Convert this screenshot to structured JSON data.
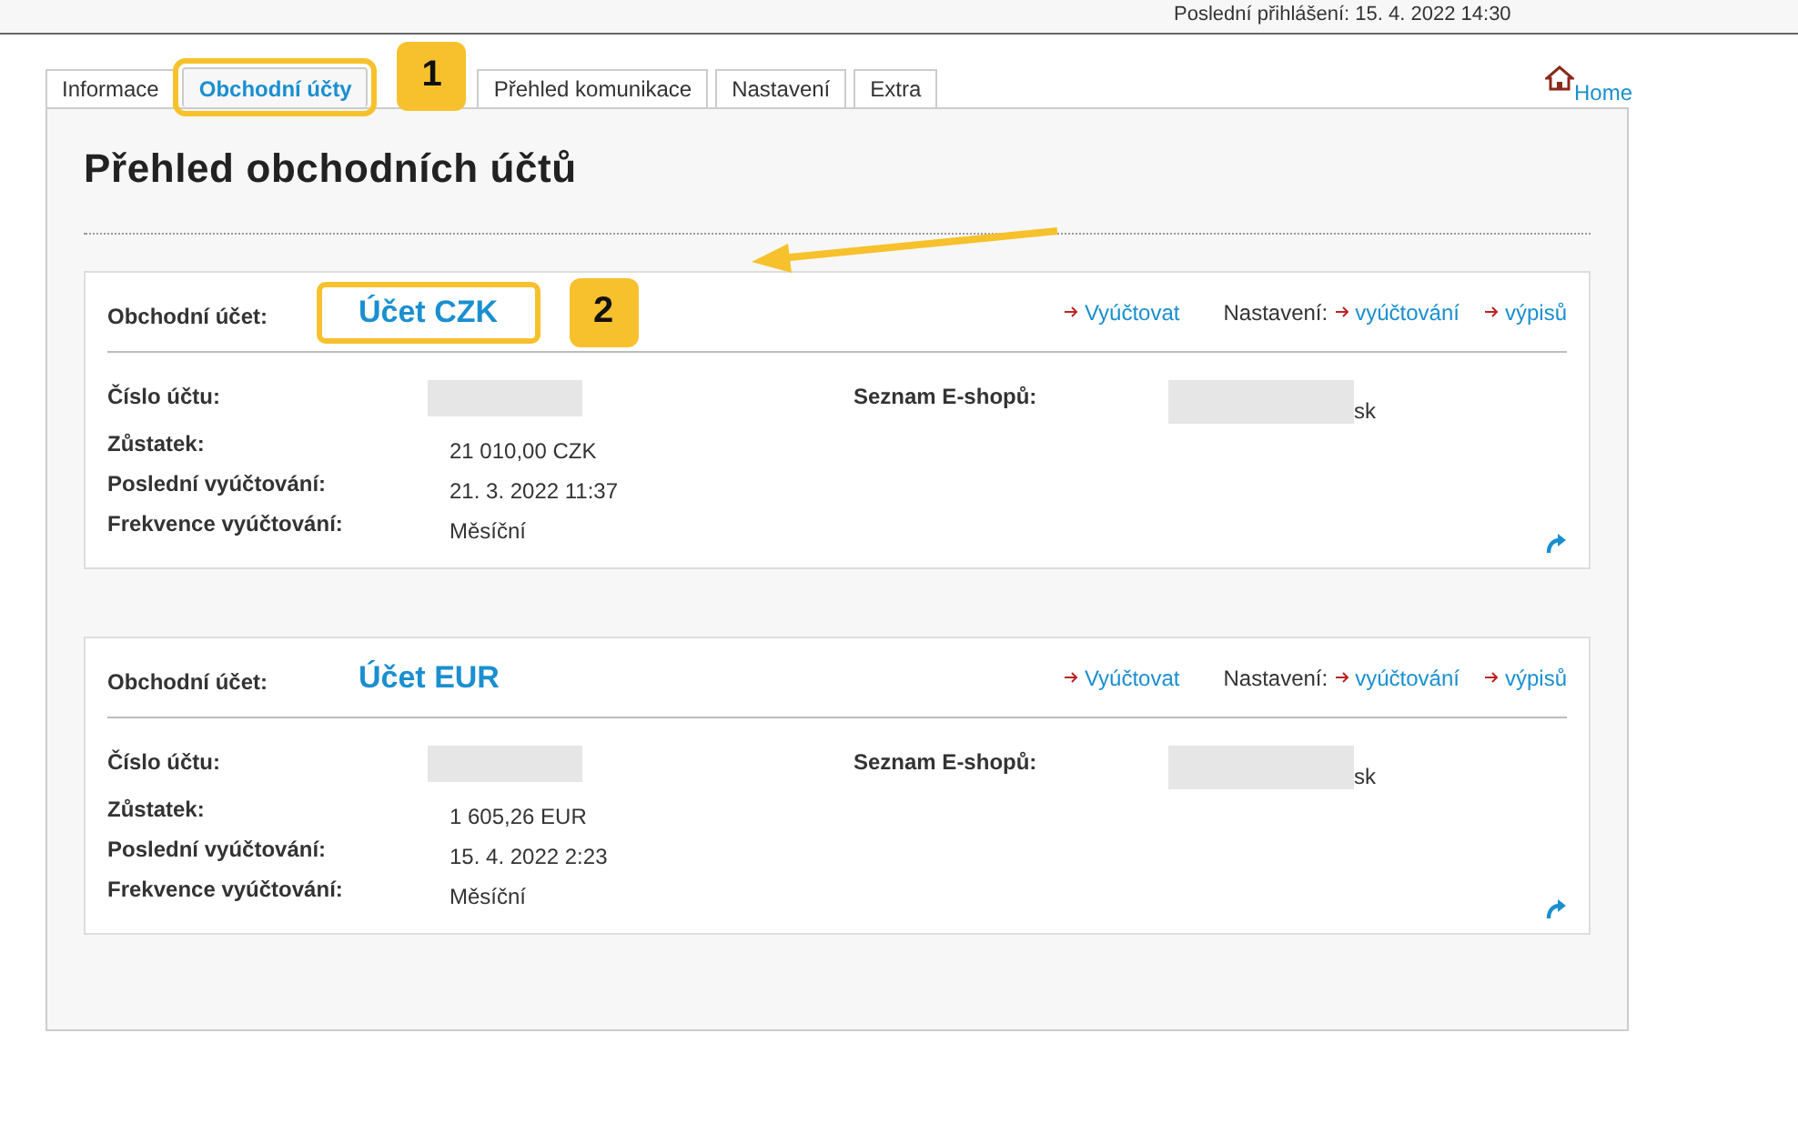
{
  "header": {
    "last_login": "Poslední přihlášení: 15. 4. 2022 14:30"
  },
  "tabs": [
    {
      "label": "Informace",
      "selected": false,
      "highlighted": false
    },
    {
      "label": "Obchodní účty",
      "selected": true,
      "highlighted": true,
      "badge": "1"
    },
    {
      "label": "Přehled komunikace",
      "selected": false,
      "highlighted": false
    },
    {
      "label": "Nastavení",
      "selected": false,
      "highlighted": false
    },
    {
      "label": "Extra",
      "selected": false,
      "highlighted": false
    }
  ],
  "home_link": "Home",
  "heading": "Přehled obchodních účtů",
  "accounts": [
    {
      "label": "Obchodní účet:",
      "name": "Účet CZK",
      "highlighted": true,
      "badge": "2",
      "actions": {
        "bill": "Vyúčtovat",
        "settings_label": "Nastavení:",
        "settings_links": [
          "vyúčtování",
          "výpisů"
        ]
      },
      "fields": [
        {
          "label": "Číslo účtu:",
          "redacted": true
        },
        {
          "label": "Zůstatek:",
          "value": "21 010,00 CZK"
        },
        {
          "label": "Poslední vyúčtování:",
          "value": "21. 3. 2022 11:37"
        },
        {
          "label": "Frekvence vyúčtování:",
          "value": "Měsíční"
        }
      ],
      "eshops": {
        "label": "Seznam E-shopů:",
        "suffix": "sk"
      }
    },
    {
      "label": "Obchodní účet:",
      "name": "Účet EUR",
      "highlighted": false,
      "actions": {
        "bill": "Vyúčtovat",
        "settings_label": "Nastavení:",
        "settings_links": [
          "vyúčtování",
          "výpisů"
        ]
      },
      "fields": [
        {
          "label": "Číslo účtu:",
          "redacted": true
        },
        {
          "label": "Zůstatek:",
          "value": "1 605,26 EUR"
        },
        {
          "label": "Poslední vyúčtování:",
          "value": "15. 4. 2022 2:23"
        },
        {
          "label": "Frekvence vyúčtování:",
          "value": "Měsíční"
        }
      ],
      "eshops": {
        "label": "Seznam E-shopů:",
        "suffix": "sk"
      }
    }
  ]
}
